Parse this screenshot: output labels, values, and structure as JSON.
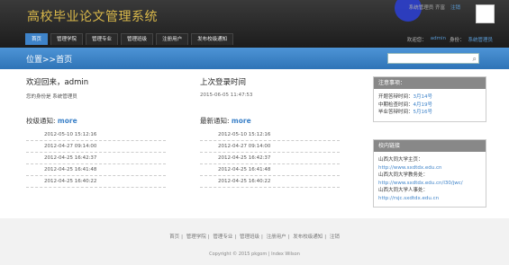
{
  "header": {
    "title": "高校毕业论文管理系统",
    "user_text": "系统管理员 齐富",
    "logout": "注销",
    "nav": [
      "首页",
      "管理学院",
      "管理专业",
      "管理班级",
      "注册用户",
      "发布校级通知"
    ],
    "account_label": "欢迎您：",
    "account_value": "admin",
    "role_label": "身份：",
    "role_value": "系统管理员"
  },
  "bar": {
    "crumb": "位置>>首页",
    "search_placeholder": ""
  },
  "main": {
    "welcome": "欢迎回来，admin",
    "identity": "您的身份是 系统管理员",
    "lastlogin_label": "上次登录时间",
    "lastlogin": "2015-06-05 11:47:53",
    "school_notice": "校级通知:",
    "latest_notice": "最新通知:",
    "more": "more",
    "school_dates": [
      "2012-05-10 15:12:16",
      "2012-04-27 09:14:00",
      "2012-04-25 16:42:37",
      "2012-04-25 16:41:48",
      "2012-04-25 16:40:22"
    ],
    "latest_dates": [
      "2012-05-10 15:12:16",
      "2012-04-27 09:14:00",
      "2012-04-25 16:42:37",
      "2012-04-25 16:41:48",
      "2012-04-25 16:40:22"
    ]
  },
  "panels": {
    "notice_title": "注意事项：",
    "notice_lines": [
      {
        "label": "开题答辩时间：",
        "value": "3月14号"
      },
      {
        "label": "中期检查时间：",
        "value": "4月19号"
      },
      {
        "label": "毕业答辩时间：",
        "value": "5月16号"
      }
    ],
    "links_title": "校内链接",
    "links": [
      {
        "label": "山西大同大学主页：",
        "url": "http://www.sxdtdx.edu.cn"
      },
      {
        "label": "山西大同大学教务处：",
        "url": "http://www.sxdtdx.edu.cn/l30/jwc/"
      },
      {
        "label": "山西大同大学人事处：",
        "url": "http://rsjc.sxdtdx.edu.cn"
      }
    ]
  },
  "footer": {
    "links": [
      "首页",
      "管理学院",
      "管理专业",
      "管理班级",
      "注册用户",
      "发布校级通知",
      "注销"
    ],
    "copyright": "Copyright © 2015  pkgom  | Index  Wilson"
  },
  "colors": {
    "accent": "#3e83c9",
    "title": "#d9b84a",
    "header": "#1c1c1c"
  }
}
